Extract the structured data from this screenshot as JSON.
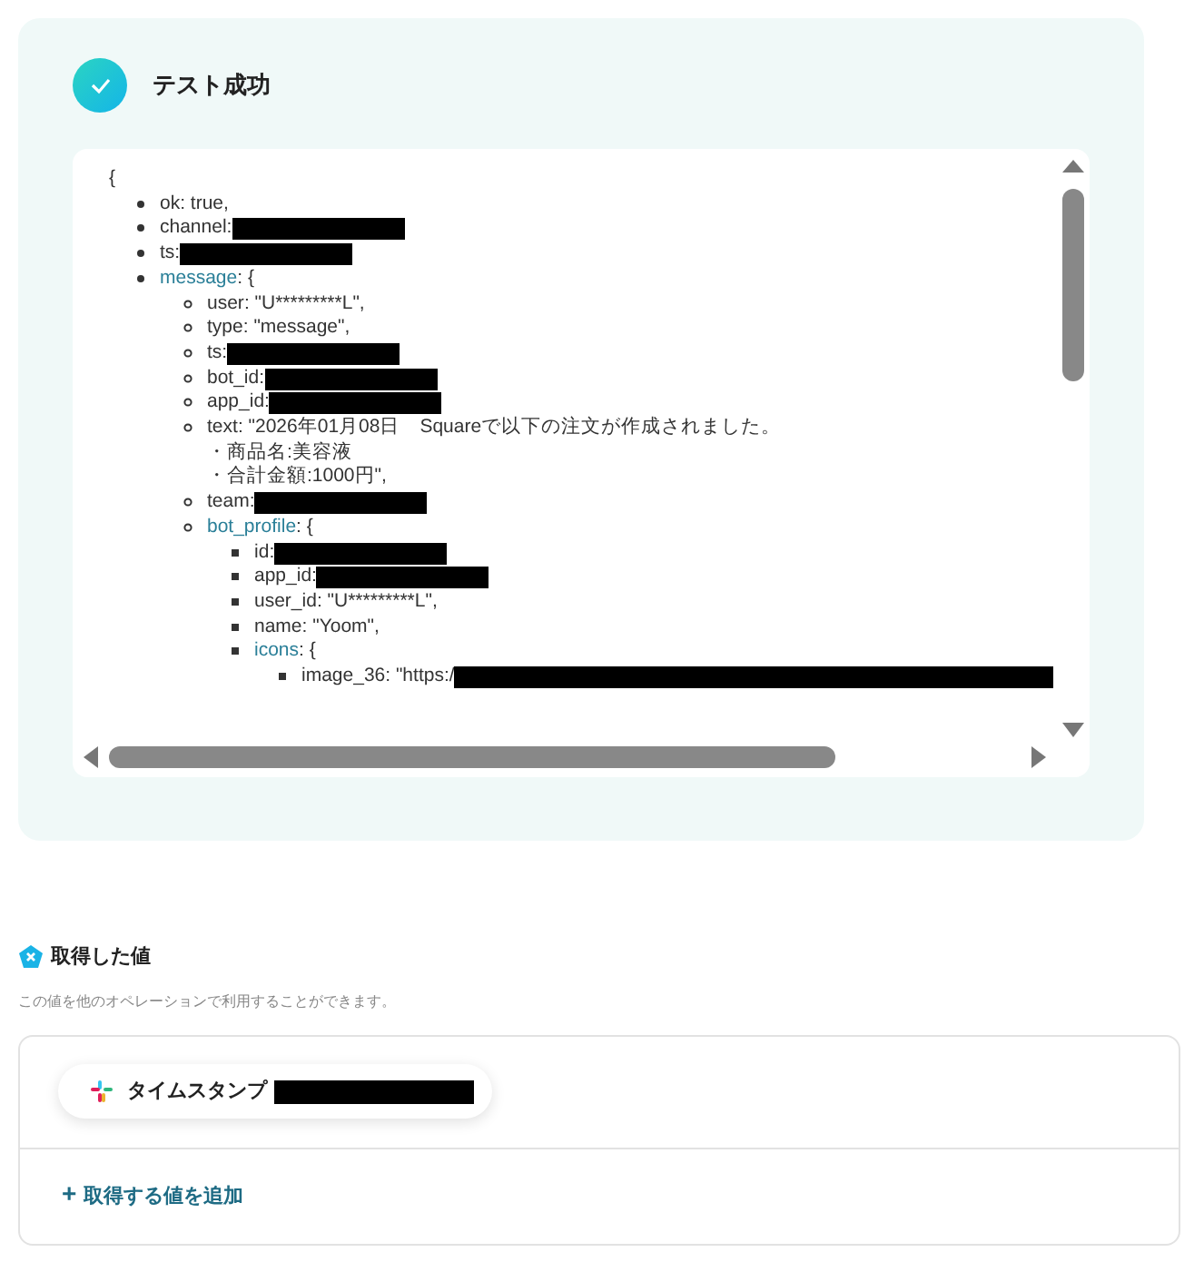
{
  "result": {
    "title": "テスト成功",
    "json_view": {
      "open": "{",
      "items": [
        {
          "key": "ok",
          "rest": ": true,"
        },
        {
          "key": "channel",
          "rest": ": ",
          "redacted": true
        },
        {
          "key": "ts",
          "rest": ":",
          "redacted": true
        },
        {
          "key": "message",
          "kind": "object",
          "rest": ": {",
          "children": [
            {
              "key": "user",
              "rest": ": \"U*********L\","
            },
            {
              "key": "type",
              "rest": ": \"message\","
            },
            {
              "key": "ts",
              "rest": ": ",
              "redacted": true
            },
            {
              "key": "bot_id",
              "rest": ": ",
              "redacted": true
            },
            {
              "key": "app_id",
              "rest": ": ",
              "redacted": true
            },
            {
              "key": "text",
              "rest": ": \"2026年01月08日　Squareで以下の注文が作成されました。",
              "continuation": [
                "・商品名:美容液",
                "・合計金額:1000円\","
              ]
            },
            {
              "key": "team",
              "rest": ":",
              "redacted": true
            },
            {
              "key": "bot_profile",
              "kind": "object",
              "rest": ": {",
              "children": [
                {
                  "key": "id",
                  "rest": ": ",
                  "redacted": true
                },
                {
                  "key": "app_id",
                  "rest": ": ",
                  "redacted": true
                },
                {
                  "key": "user_id",
                  "rest": ": \"U*********L\","
                },
                {
                  "key": "name",
                  "rest": ": \"Yoom\","
                },
                {
                  "key": "icons",
                  "kind": "object",
                  "rest": ": {",
                  "children": [
                    {
                      "key": "image_36",
                      "rest": ": \"https:/",
                      "redacted": true
                    }
                  ]
                }
              ]
            }
          ]
        }
      ]
    }
  },
  "acquired": {
    "title": "取得した値",
    "description": "この値を他のオペレーションで利用することができます。",
    "values": [
      {
        "label": "タイムスタンプ",
        "redacted": true
      }
    ],
    "add_link": {
      "icon": "+",
      "label": "取得する値を追加"
    }
  }
}
